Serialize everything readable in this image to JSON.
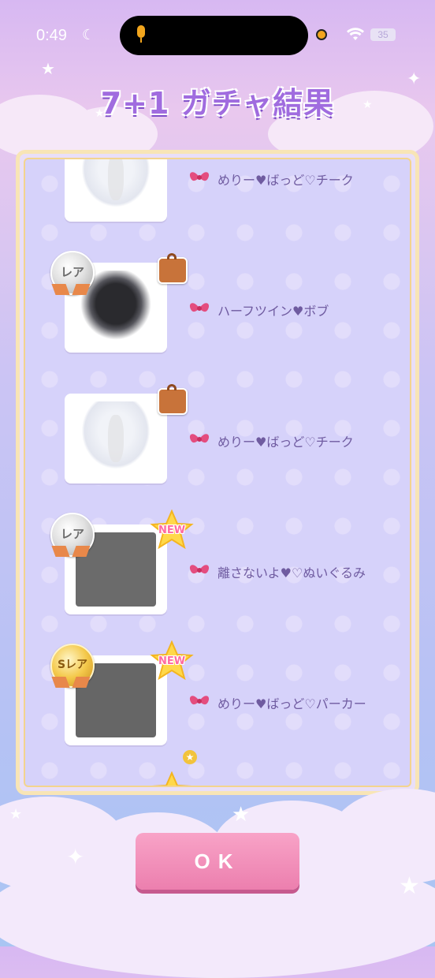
{
  "status_bar": {
    "time": "0:49",
    "battery": "35"
  },
  "title": "7+1 ガチャ結果",
  "items": [
    {
      "name": "めりー♥ばっど♡チーク",
      "rarity": "",
      "new": false,
      "owned_icon": false,
      "thumb": "ghost"
    },
    {
      "name": "ハーフツイン♥ボブ",
      "rarity": "レア",
      "new": false,
      "owned_icon": true,
      "thumb": "hair"
    },
    {
      "name": "めりー♥ばっど♡チーク",
      "rarity": "",
      "new": false,
      "owned_icon": true,
      "thumb": "ghost"
    },
    {
      "name": "離さないよ♥♡ぬいぐるみ",
      "rarity": "レア",
      "new": true,
      "owned_icon": false,
      "thumb": "plush"
    },
    {
      "name": "めりー♥ばっど♡パーカー",
      "rarity": "Sレア",
      "new": true,
      "owned_icon": false,
      "thumb": "hoodie"
    }
  ],
  "labels": {
    "rare": "レア",
    "super_rare": "Sレア",
    "new": "NEW"
  },
  "ok_button": "OK",
  "colors": {
    "title": "#a06cdf",
    "item_text": "#6f5ba0",
    "ok_button": "#ec7fae",
    "panel_border": "#f3d48e"
  }
}
